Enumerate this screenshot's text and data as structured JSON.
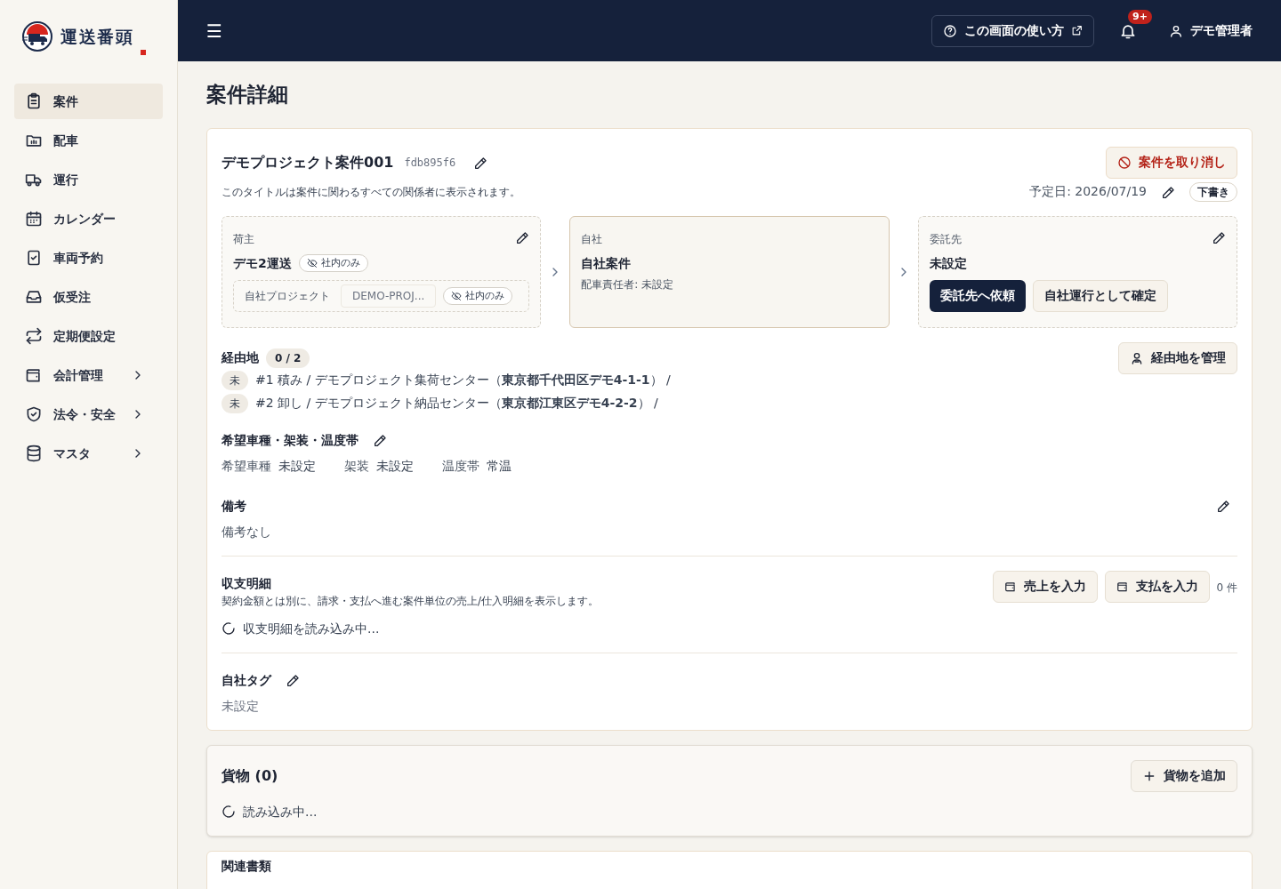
{
  "brand": {
    "name": "運送番頭"
  },
  "sidebar": {
    "items": [
      {
        "label": "案件",
        "selected": true,
        "expandable": false
      },
      {
        "label": "配車",
        "selected": false,
        "expandable": false
      },
      {
        "label": "運行",
        "selected": false,
        "expandable": false
      },
      {
        "label": "カレンダー",
        "selected": false,
        "expandable": false
      },
      {
        "label": "車両予約",
        "selected": false,
        "expandable": false
      },
      {
        "label": "仮受注",
        "selected": false,
        "expandable": false
      },
      {
        "label": "定期便設定",
        "selected": false,
        "expandable": false
      },
      {
        "label": "会計管理",
        "selected": false,
        "expandable": true
      },
      {
        "label": "法令・安全",
        "selected": false,
        "expandable": true
      },
      {
        "label": "マスタ",
        "selected": false,
        "expandable": true
      }
    ]
  },
  "header": {
    "menu": "☰",
    "help_button": "この画面の使い方",
    "notification_badge": "9+",
    "user": "デモ管理者"
  },
  "page_title": "案件詳細",
  "case": {
    "title": "デモプロジェクト案件001",
    "id": "fdb895f6",
    "cancel_button": "案件を取り消し",
    "title_note": "このタイトルは案件に関わるすべての関係者に表示されます。",
    "scheduled_date": "予定日: 2026/07/19",
    "status": "下書き"
  },
  "parties": [
    {
      "kind": "shipper",
      "label": "荷主",
      "name": "デモ2運送",
      "visibility": "社内のみ",
      "project_label": "自社プロジェクト",
      "project_value": "DEMO-PROJ...",
      "project_visibility": "社内のみ"
    },
    {
      "kind": "own",
      "label": "自社",
      "name": "自社案件",
      "note": "配車責任者: 未設定"
    },
    {
      "kind": "carrier",
      "label": "委託先",
      "name": "未設定",
      "buttons": [
        "委託先へ依頼",
        "自社運行として確定"
      ]
    }
  ],
  "waypoints": {
    "title": "経由地",
    "count": "0 / 2",
    "manage_button": "経由地を管理",
    "items": [
      {
        "status": "未",
        "text": "#1 積み / デモプロジェクト集荷センター（**東京都千代田区デモ4-1-1**） /"
      },
      {
        "status": "未",
        "text": "#2 卸し / デモプロジェクト納品センター（**東京都江東区デモ4-2-2**） /"
      }
    ]
  },
  "vehicle": {
    "title": "希望車種・架装・温度帯",
    "fields": [
      {
        "label": "希望車種",
        "value": "未設定"
      },
      {
        "label": "架装",
        "value": "未設定"
      },
      {
        "label": "温度帯",
        "value": "常温"
      }
    ]
  },
  "remarks": {
    "title": "備考",
    "value": "備考なし"
  },
  "ledger": {
    "title": "収支明細",
    "note": "契約金額とは別に、請求・支払へ進む案件単位の売上/仕入明細を表示します。",
    "buttons": [
      "売上を入力",
      "支払を入力"
    ],
    "count": "0 件",
    "loading": "収支明細を読み込み中..."
  },
  "tags": {
    "title": "自社タグ",
    "value": "未設定"
  },
  "cargo": {
    "title": "貨物 (0)",
    "add_button": "貨物を追加",
    "loading": "読み込み中..."
  },
  "documents": {
    "title": "関連書類"
  }
}
